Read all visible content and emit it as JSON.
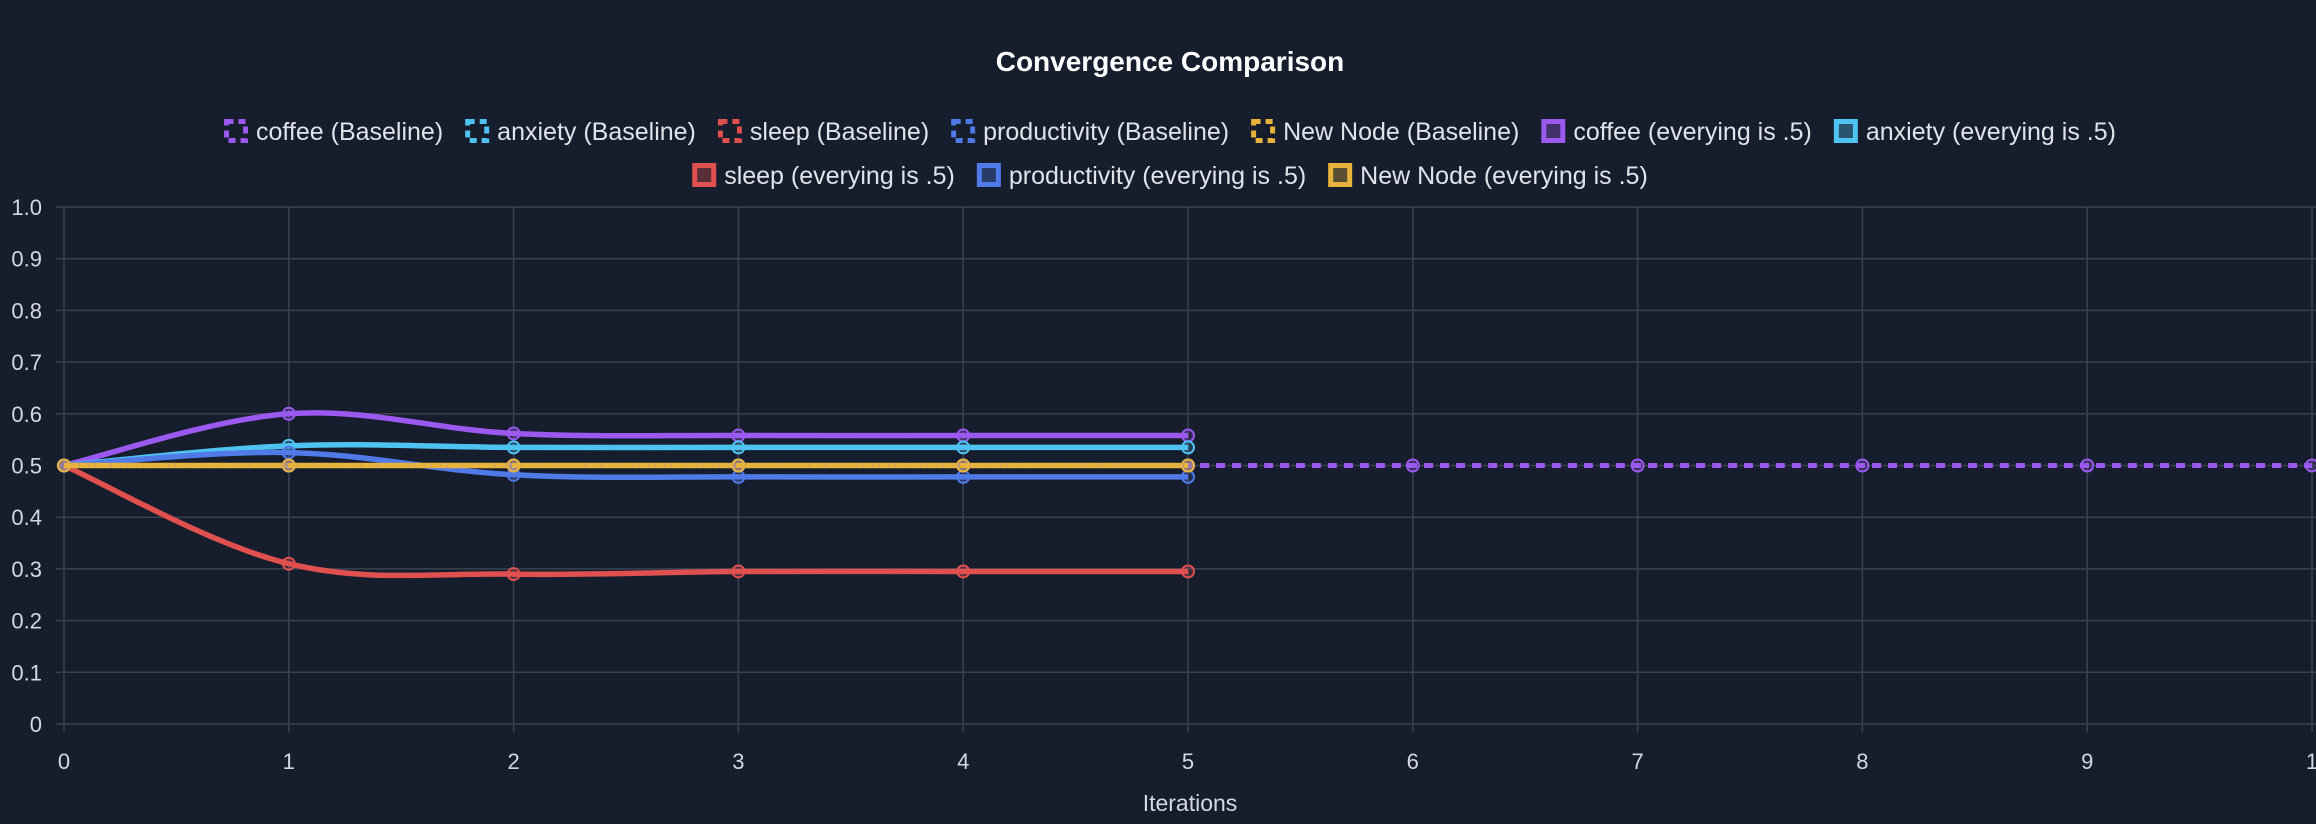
{
  "chart_data": {
    "type": "line",
    "title": "Convergence Comparison",
    "xlabel": "Iterations",
    "ylabel": "",
    "xlim": [
      0,
      10
    ],
    "ylim": [
      0,
      1
    ],
    "x_ticks": [
      "0",
      "1",
      "2",
      "3",
      "4",
      "5",
      "6",
      "7",
      "8",
      "9",
      "1"
    ],
    "y_ticks": [
      "0",
      "0.1",
      "0.2",
      "0.3",
      "0.4",
      "0.5",
      "0.6",
      "0.7",
      "0.8",
      "0.9",
      "1.0"
    ],
    "grid": true,
    "legend_position": "top-center",
    "series": [
      {
        "name": "coffee (Baseline)",
        "color": "#9b59f0",
        "dashed": true,
        "x": [
          0,
          1,
          2,
          3,
          4,
          5,
          6,
          7,
          8,
          9,
          10
        ],
        "values": [
          0.5,
          0.5,
          0.5,
          0.5,
          0.5,
          0.5,
          0.5,
          0.5,
          0.5,
          0.5,
          0.5
        ]
      },
      {
        "name": "anxiety  (Baseline)",
        "color": "#4ec3f2",
        "dashed": true,
        "x": [
          0,
          1,
          2,
          3,
          4,
          5
        ],
        "values": [
          0.5,
          0.5,
          0.5,
          0.5,
          0.5,
          0.5
        ]
      },
      {
        "name": "sleep (Baseline)",
        "color": "#e0504f",
        "dashed": true,
        "x": [
          0,
          1,
          2,
          3,
          4,
          5
        ],
        "values": [
          0.5,
          0.5,
          0.5,
          0.5,
          0.5,
          0.5
        ]
      },
      {
        "name": "productivity (Baseline)",
        "color": "#4f7ae8",
        "dashed": true,
        "x": [
          0,
          1,
          2,
          3,
          4,
          5
        ],
        "values": [
          0.5,
          0.5,
          0.5,
          0.5,
          0.5,
          0.5
        ]
      },
      {
        "name": "New Node (Baseline)",
        "color": "#e8b33c",
        "dashed": true,
        "x": [
          0,
          1,
          2,
          3,
          4,
          5
        ],
        "values": [
          0.5,
          0.5,
          0.5,
          0.5,
          0.5,
          0.5
        ]
      },
      {
        "name": "coffee (everying is .5)",
        "color": "#9b59f0",
        "dashed": false,
        "x": [
          0,
          1,
          2,
          3,
          4,
          5
        ],
        "values": [
          0.5,
          0.6,
          0.562,
          0.558,
          0.558,
          0.558
        ]
      },
      {
        "name": "anxiety  (everying is .5)",
        "color": "#4ec3f2",
        "dashed": false,
        "x": [
          0,
          1,
          2,
          3,
          4,
          5
        ],
        "values": [
          0.5,
          0.538,
          0.535,
          0.535,
          0.535,
          0.535
        ]
      },
      {
        "name": "sleep (everying is .5)",
        "color": "#e0504f",
        "dashed": false,
        "x": [
          0,
          1,
          2,
          3,
          4,
          5
        ],
        "values": [
          0.5,
          0.31,
          0.29,
          0.295,
          0.295,
          0.295
        ]
      },
      {
        "name": "productivity (everying is .5)",
        "color": "#4f7ae8",
        "dashed": false,
        "x": [
          0,
          1,
          2,
          3,
          4,
          5
        ],
        "values": [
          0.5,
          0.525,
          0.482,
          0.478,
          0.478,
          0.478
        ]
      },
      {
        "name": "New Node (everying is .5)",
        "color": "#e8b33c",
        "dashed": false,
        "x": [
          0,
          1,
          2,
          3,
          4,
          5
        ],
        "values": [
          0.5,
          0.5,
          0.5,
          0.5,
          0.5,
          0.5
        ]
      }
    ]
  }
}
